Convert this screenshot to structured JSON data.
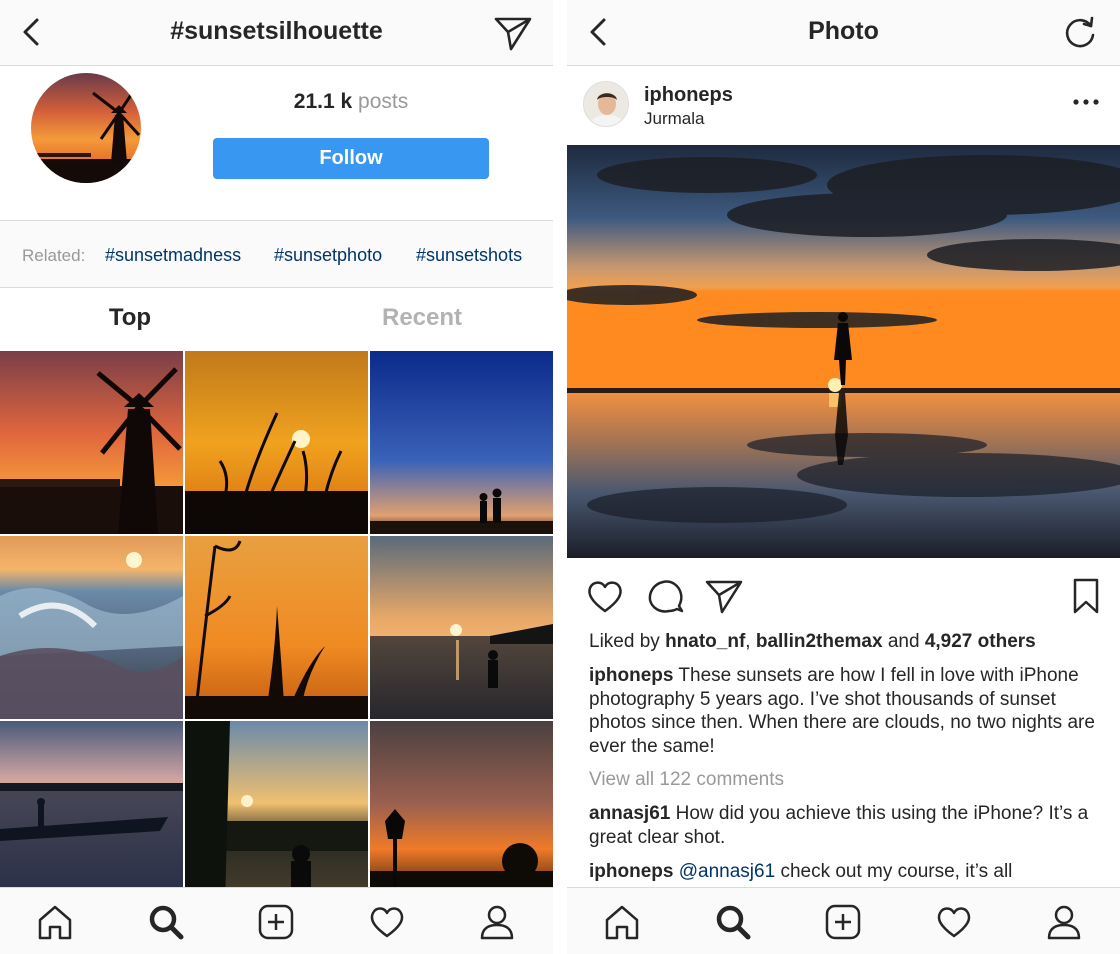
{
  "left": {
    "header": {
      "title": "#sunsetsilhouette"
    },
    "stats": {
      "count": "21.1 k",
      "label": "posts"
    },
    "follow_label": "Follow",
    "related": {
      "label": "Related:",
      "tags": [
        "#sunsetmadness",
        "#sunsetphoto",
        "#sunsetshots"
      ]
    },
    "tabs": [
      {
        "label": "Top",
        "active": true
      },
      {
        "label": "Recent",
        "active": false
      }
    ]
  },
  "right": {
    "header": {
      "title": "Photo"
    },
    "post": {
      "username": "iphoneps",
      "location": "Jurmala",
      "likes": {
        "prefix": "Liked by",
        "user1": "hnato_nf",
        "sep": ",",
        "user2": "ballin2themax",
        "and": "and",
        "others": "4,927 others"
      },
      "caption": {
        "username": "iphoneps",
        "text": "These sunsets are how I fell in love with iPhone photography 5 years ago. I’ve shot thousands of sunset photos since then. When there are clouds, no two nights are ever the same!"
      },
      "view_all": "View all 122 comments",
      "comments": [
        {
          "username": "annasj61",
          "text": "How did you achieve this using the iPhone? It’s a great clear shot."
        },
        {
          "username": "iphoneps",
          "mention": "@annasj61",
          "text": "check out my course, it’s all"
        }
      ]
    }
  },
  "icons": {
    "back": "chevron-left-icon",
    "send": "paper-plane-icon",
    "refresh": "refresh-icon",
    "more": "ellipsis-icon",
    "heart": "heart-icon",
    "comment": "comment-icon",
    "bookmark": "bookmark-icon",
    "home": "home-icon",
    "search": "search-icon",
    "add": "add-post-icon",
    "activity": "heart-icon",
    "profile": "profile-icon"
  },
  "colors": {
    "follow": "#3897f0",
    "hashtag_link": "#003569",
    "muted": "#999999",
    "text": "#262626",
    "border": "#dbdbdb",
    "bar_bg": "#fafafa"
  }
}
